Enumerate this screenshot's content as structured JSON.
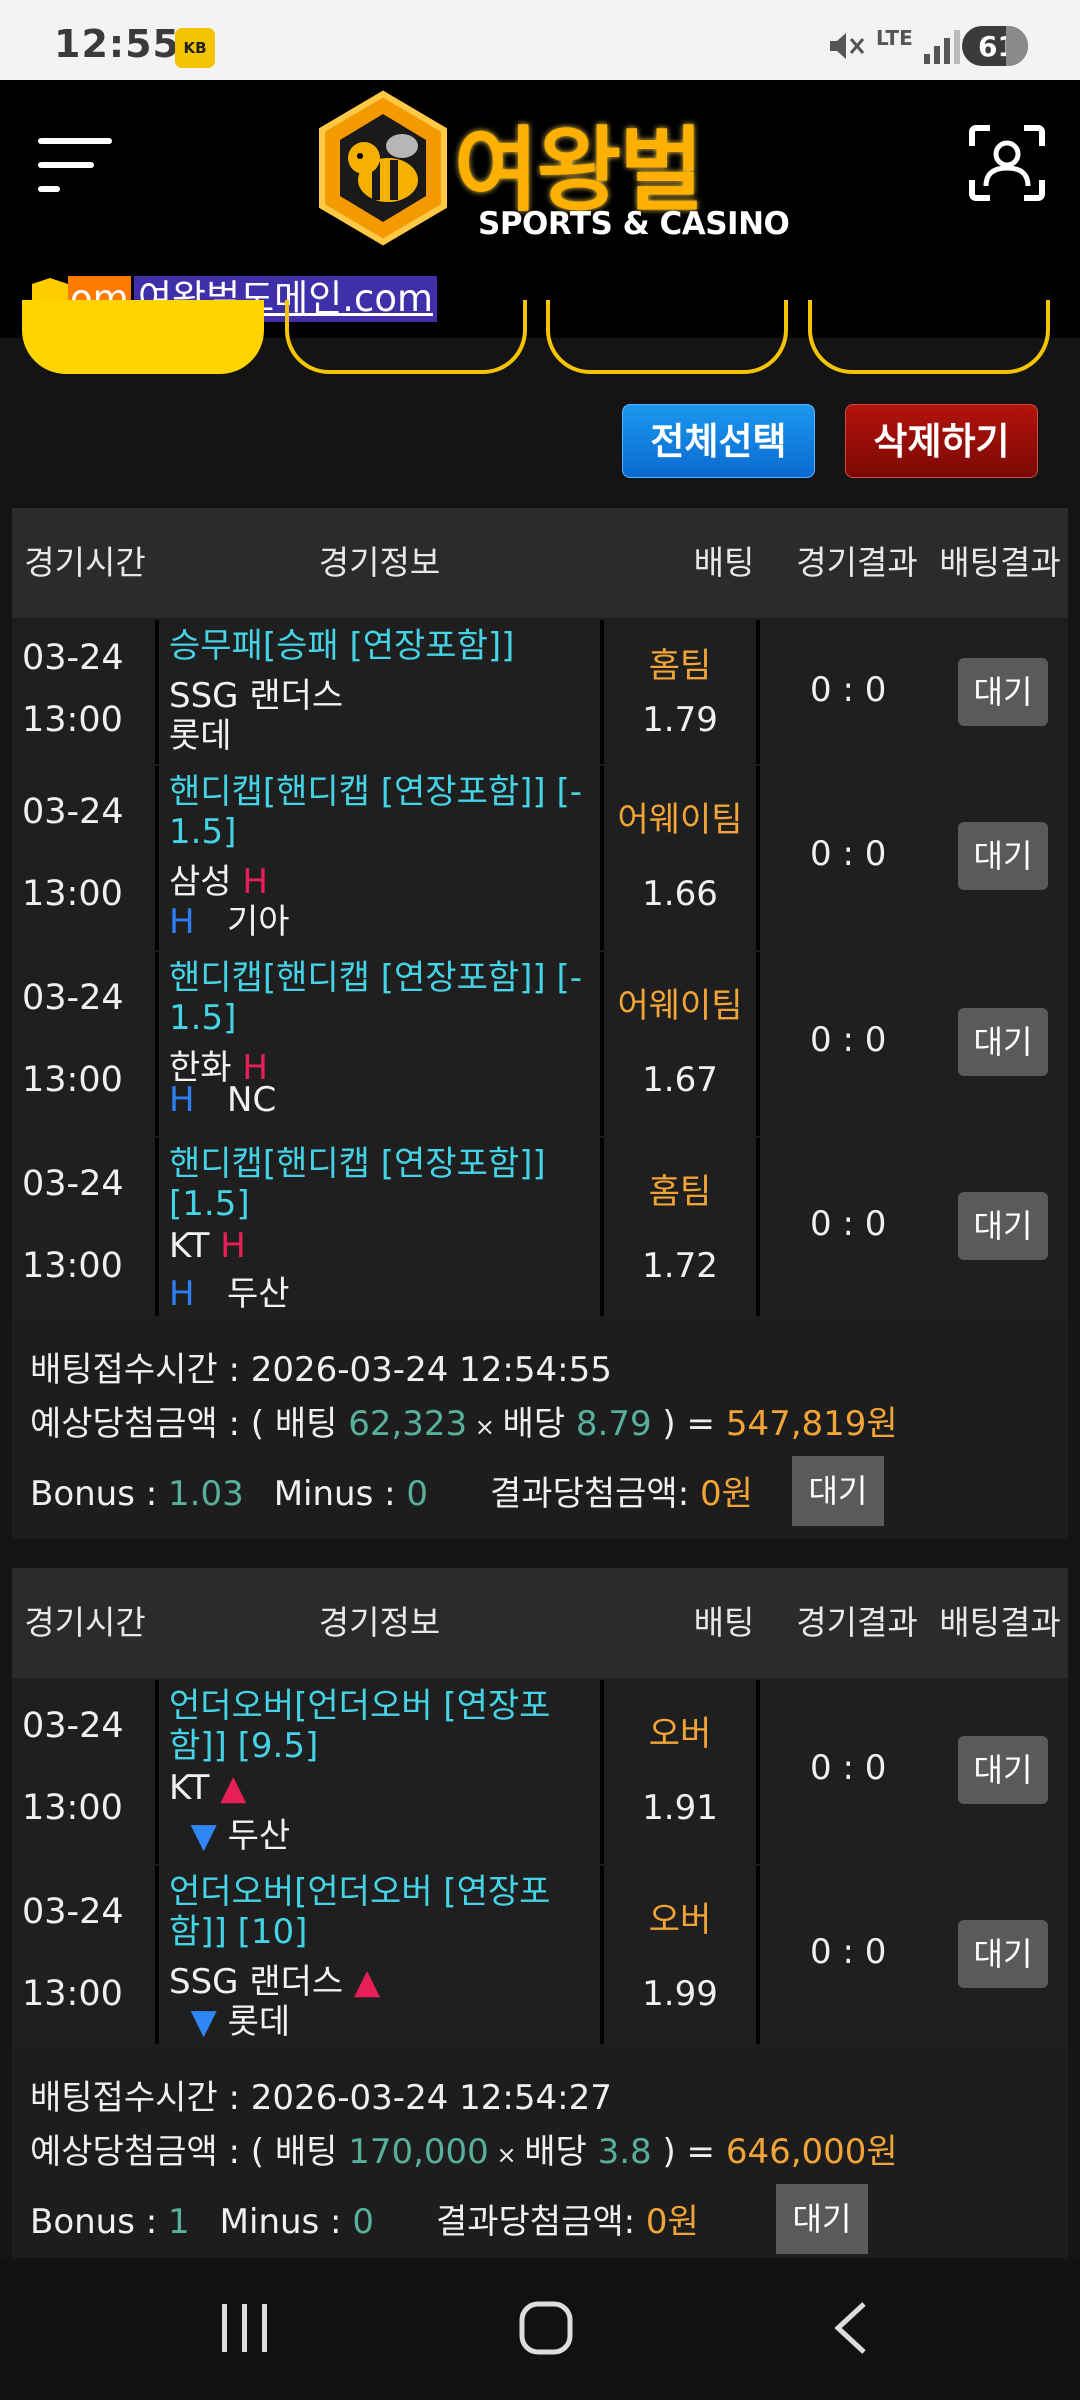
{
  "status_bar": {
    "time": "12:55",
    "lte": "LTE",
    "battery": "61"
  },
  "header": {
    "logo_title": "여왕벌",
    "logo_subtitle": "SPORTS & CASINO"
  },
  "marquee": {
    "prefix": "om",
    "domain": "여왕벌도메인.com"
  },
  "actions": {
    "select_all": "전체선택",
    "delete": "삭제하기"
  },
  "table_headers": {
    "time": "경기시간",
    "info": "경기정보",
    "bet": "배팅",
    "result": "경기결과",
    "bet_result": "배팅결과"
  },
  "bets": [
    {
      "rows": [
        {
          "date": "03-24",
          "time": "13:00",
          "market": "승무패[승패 [연장포함]]",
          "home": "SSG 랜더스",
          "away": "롯데",
          "pick": "홈팀",
          "odds": "1.79",
          "score": "0 : 0",
          "status": "대기",
          "marker": ""
        },
        {
          "date": "03-24",
          "time": "13:00",
          "market": "핸디캡[핸디캡 [연장포함]] [-1.5]",
          "home": "삼성",
          "away": "기아",
          "pick": "어웨이팀",
          "odds": "1.66",
          "score": "0 : 0",
          "status": "대기",
          "marker": "H"
        },
        {
          "date": "03-24",
          "time": "13:00",
          "market": "핸디캡[핸디캡 [연장포함]] [-1.5]",
          "home": "한화",
          "away": "NC",
          "pick": "어웨이팀",
          "odds": "1.67",
          "score": "0 : 0",
          "status": "대기",
          "marker": "H"
        },
        {
          "date": "03-24",
          "time": "13:00",
          "market": "핸디캡[핸디캡 [연장포함]] [1.5]",
          "home": "KT",
          "away": "두산",
          "pick": "홈팀",
          "odds": "1.72",
          "score": "0 : 0",
          "status": "대기",
          "marker": "H"
        }
      ],
      "summary": {
        "received_label": "배팅접수시간 : ",
        "received": "2026-03-24 12:54:55",
        "expected_label": "예상당첨금액 : ( 배팅 ",
        "amount": "62,323",
        "times": " × ",
        "odds_label": "배당 ",
        "total_odds": "8.79",
        "close": " ) = ",
        "payout": "547,819원",
        "bonus_label": "Bonus : ",
        "bonus": "1.03",
        "minus_label": "Minus : ",
        "minus": "0",
        "result_label": "결과당첨금액: ",
        "result": "0원",
        "status": "대기"
      }
    },
    {
      "rows": [
        {
          "date": "03-24",
          "time": "13:00",
          "market": "언더오버[언더오버 [연장포함]] [9.5]",
          "home": "KT",
          "away": "두산",
          "pick": "오버",
          "odds": "1.91",
          "score": "0 : 0",
          "status": "대기",
          "marker": "▲▼"
        },
        {
          "date": "03-24",
          "time": "13:00",
          "market": "언더오버[언더오버 [연장포함]] [10]",
          "home": "SSG 랜더스",
          "away": "롯데",
          "pick": "오버",
          "odds": "1.99",
          "score": "0 : 0",
          "status": "대기",
          "marker": "▲▼"
        }
      ],
      "summary": {
        "received_label": "배팅접수시간 : ",
        "received": "2026-03-24 12:54:27",
        "expected_label": "예상당첨금액 : ( 배팅 ",
        "amount": "170,000",
        "times": " × ",
        "odds_label": "배당 ",
        "total_odds": "3.8",
        "close": " ) = ",
        "payout": "646,000원",
        "bonus_label": "Bonus : ",
        "bonus": "1",
        "minus_label": "Minus : ",
        "minus": "0",
        "result_label": "결과당첨금액: ",
        "result": "0원",
        "status": "대기"
      }
    }
  ],
  "colors": {
    "accent_yellow": "#ffd400",
    "select_blue": "#0a7fe0",
    "delete_red": "#9a0f08",
    "market_cyan": "#45d3e6",
    "pick_orange": "#f2a437"
  }
}
